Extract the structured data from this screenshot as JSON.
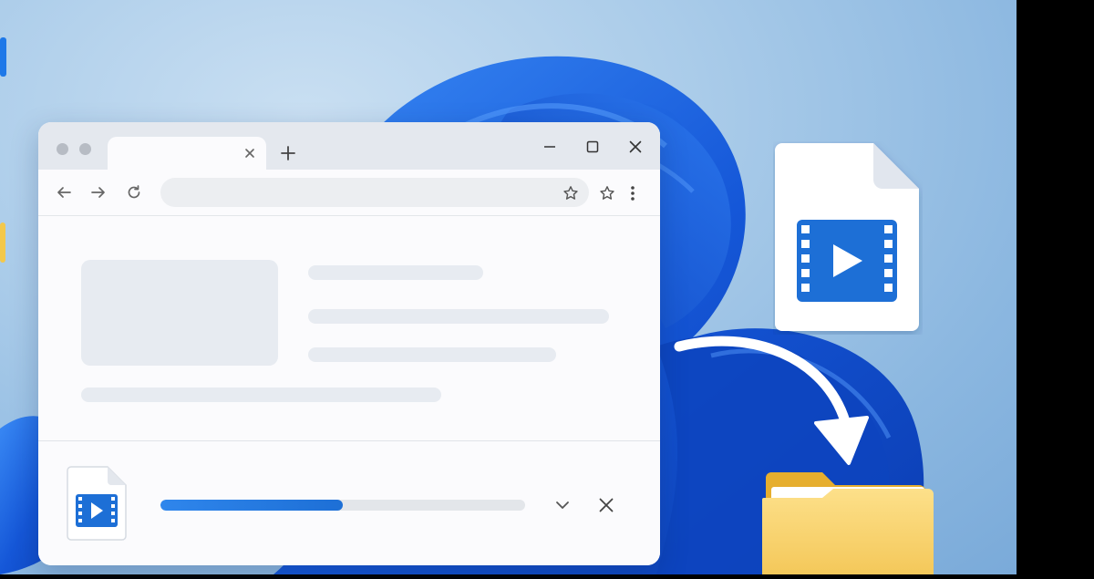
{
  "desktop": {
    "background_color": "#a9cbe9",
    "bloom_color": "#1557d8",
    "edge_icons": [
      "app-icon",
      "folder-icon"
    ]
  },
  "browser": {
    "tabs": [
      {
        "label": "",
        "close_icon": "close-icon"
      }
    ],
    "new_tab_icon": "plus-icon",
    "window_controls": [
      "minimize-icon",
      "maximize-icon",
      "close-icon"
    ],
    "toolbar": {
      "back_icon": "arrow-left-icon",
      "forward_icon": "arrow-right-icon",
      "reload_icon": "reload-icon",
      "address_value": "",
      "bookmark_icon": "star-icon",
      "menu_icon": "kebab-menu-icon"
    },
    "accent_color": "#1d6fd6"
  },
  "download": {
    "file_icon": "video-file-icon",
    "progress": 0.5,
    "expand_icon": "chevron-down-icon",
    "cancel_icon": "close-icon"
  },
  "illustration": {
    "file_icon": "video-file-icon",
    "arrow_icon": "curved-arrow-icon",
    "folder_icon": "folder-icon",
    "folder_color": "#f6d36b"
  }
}
